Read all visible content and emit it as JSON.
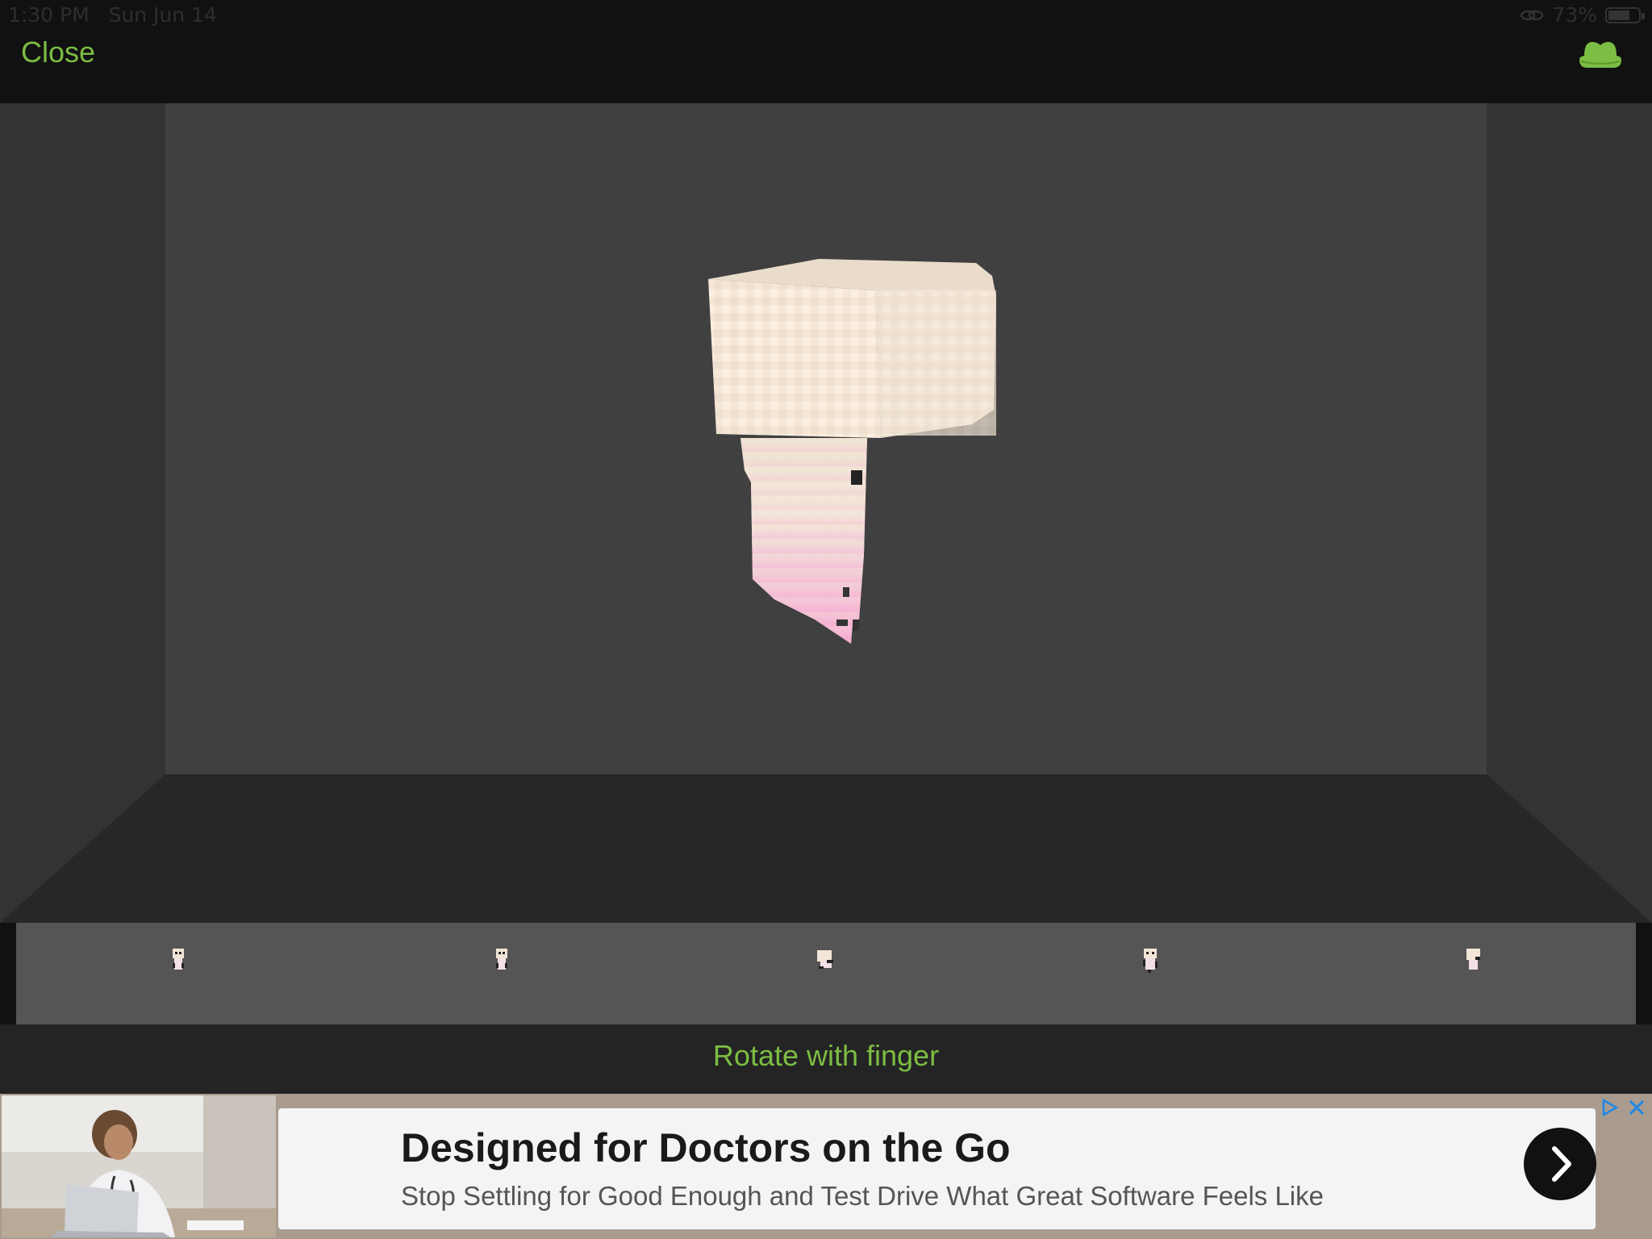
{
  "status_bar": {
    "time": "1:30 PM",
    "date": "Sun Jun 14",
    "battery_percent": "73%",
    "battery_level": 0.73
  },
  "nav": {
    "close_label": "Close",
    "hat_icon": "hat-icon"
  },
  "viewer": {
    "hint": "Rotate with finger",
    "poses": [
      "pose-standing",
      "pose-standing-2",
      "pose-sitting",
      "pose-walking",
      "pose-waving"
    ]
  },
  "ad": {
    "title": "Designed for Doctors on the Go",
    "subtitle": "Stop Settling for Good Enough and Test Drive What Great Software Feels Like"
  },
  "colors": {
    "accent": "#7cbd43",
    "background": "#111111",
    "viewer_bg": "#404040",
    "floor": "#2c2c2c"
  }
}
